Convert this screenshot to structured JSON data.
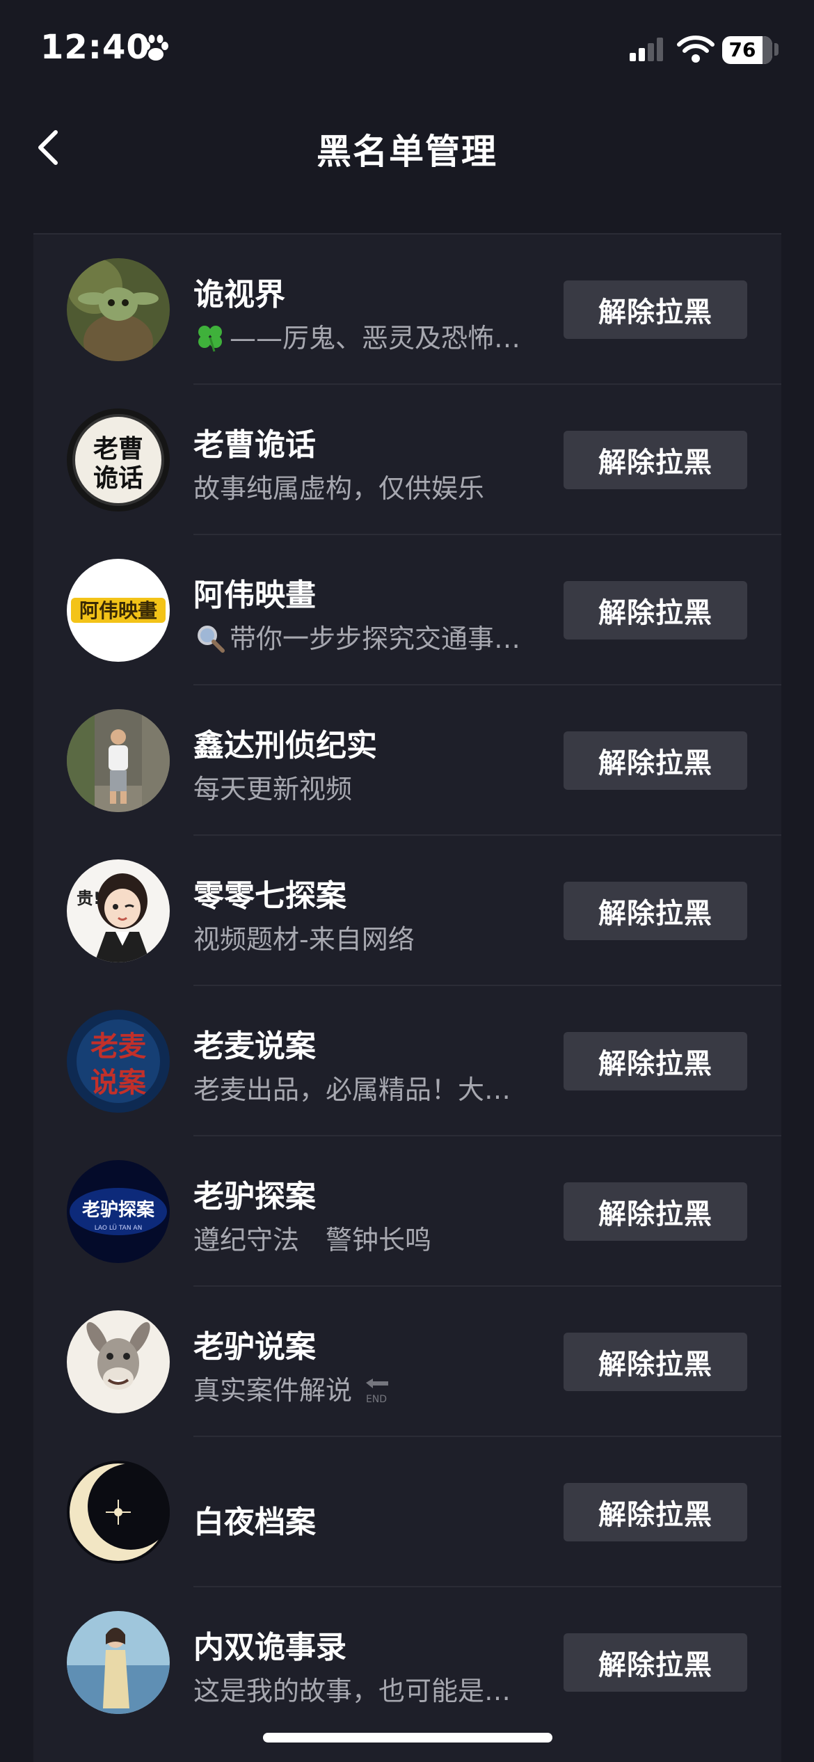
{
  "status_bar": {
    "time": "12:40",
    "battery": "76"
  },
  "nav": {
    "title": "黑名单管理"
  },
  "unblock_label": "解除拉黑",
  "users": [
    {
      "name": "诡视界",
      "sig_icon": "clover-icon",
      "signature": "——厉鬼、恶灵及恐怖…"
    },
    {
      "name": "老曹诡话",
      "signature": "故事纯属虚构，仅供娱乐"
    },
    {
      "name": "阿伟映畫",
      "sig_icon": "magnifier-icon",
      "signature": "带你一步步探究交通事…"
    },
    {
      "name": "鑫达刑侦纪实",
      "signature": "每天更新视频"
    },
    {
      "name": "零零七探案",
      "signature": "视频题材-来自网络"
    },
    {
      "name": "老麦说案",
      "signature": "老麦出品，必属精品！大…"
    },
    {
      "name": "老驴探案",
      "signature": "遵纪守法　警钟长鸣"
    },
    {
      "name": "老驴说案",
      "signature": "真实案件解说",
      "sig_trail_icon": "end-arrow-icon",
      "sig_trail_text": "END"
    },
    {
      "name": "白夜档案",
      "signature": ""
    },
    {
      "name": "内双诡事录",
      "signature": "这是我的故事，也可能是…"
    }
  ],
  "avatar_text": {
    "laocao": [
      "老曹",
      "诡话"
    ],
    "awei": "阿伟映畫",
    "laomai": [
      "老麦",
      "说案"
    ],
    "laolv": "老驴探案",
    "laolv_sub": "LAO LÜ TAN AN",
    "zero_side": "贵!"
  },
  "colors": {
    "background": "#181922",
    "list_bg": "#1e1f29",
    "button_bg": "#393a44",
    "secondary_text": "#a7a8b0"
  }
}
